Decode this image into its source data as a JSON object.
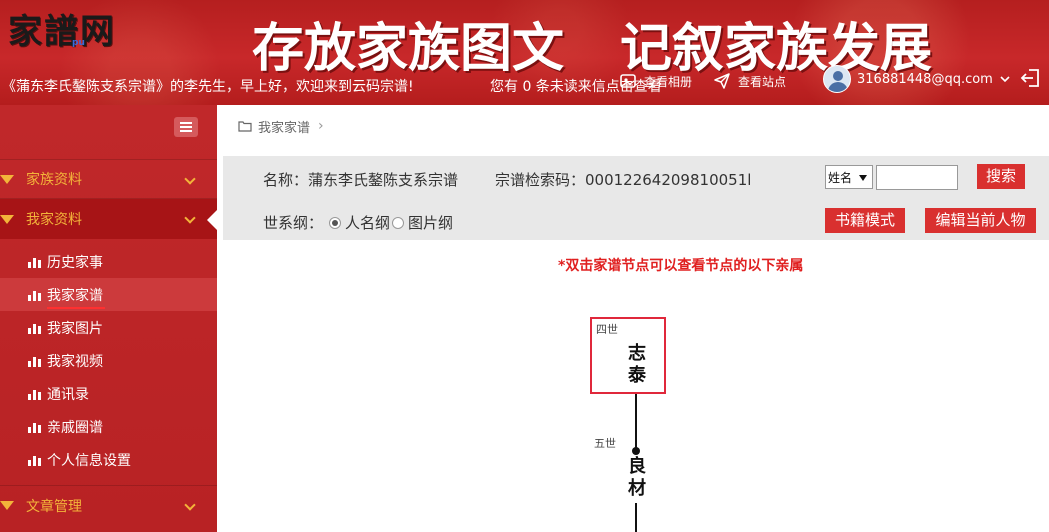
{
  "header": {
    "logo_text": "家譜网",
    "logo_sub": "pu",
    "slogan_left": "存放家族图文",
    "slogan_right": "记叙家族发展",
    "welcome": "《蒲东李氏鏊陈支系宗谱》的李先生，早上好，欢迎来到云码宗谱!",
    "unread": "您有 0 条未读来信点击查看",
    "nav_album": "查看相册",
    "nav_site": "查看站点",
    "user_email": "316881448@qq.com"
  },
  "sidebar": {
    "sections": [
      {
        "label": "家族资料"
      },
      {
        "label": "我家资料"
      },
      {
        "label": "文章管理"
      }
    ],
    "items": [
      {
        "label": "历史家事"
      },
      {
        "label": "我家家谱"
      },
      {
        "label": "我家图片"
      },
      {
        "label": "我家视频"
      },
      {
        "label": "通讯录"
      },
      {
        "label": "亲戚圈谱"
      },
      {
        "label": "个人信息设置"
      }
    ]
  },
  "breadcrumb": {
    "label": "我家家谱"
  },
  "panel": {
    "name": "名称：蒲东李氏鏊陈支系宗谱",
    "code": "宗谱检索码：00012264209810051l",
    "select_value": "姓名",
    "search_value": "",
    "search_button": "搜索",
    "shixi_label": "世系纲：",
    "radio_person": "人名纲",
    "radio_picture": "图片纲",
    "book_button": "书籍模式",
    "edit_button": "编辑当前人物"
  },
  "hint": "*双击家谱节点可以查看节点的以下亲属",
  "tree": {
    "nodes": [
      {
        "generation": "四世",
        "name": "志泰"
      },
      {
        "generation": "五世",
        "name": "良材"
      }
    ]
  },
  "colors": {
    "primary_red": "#c8282a",
    "sidebar_red": "#b82224",
    "accent_gold": "#f3b43a",
    "button_red": "#d9302f",
    "hint_red": "#e02020"
  }
}
